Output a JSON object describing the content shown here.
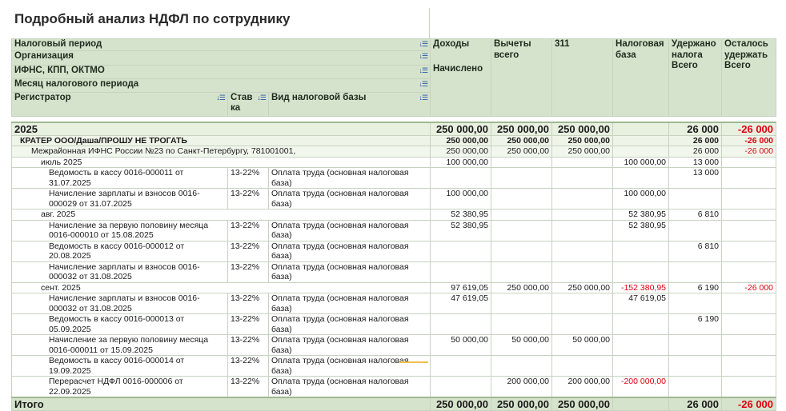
{
  "title": "Подробный анализ НДФЛ по сотруднику",
  "headers": {
    "tax_period": "Налоговый период",
    "organization": "Организация",
    "ifns": "ИФНС, КПП, ОКТМО",
    "month": "Месяц налогового периода",
    "registrar": "Регистратор",
    "rate": "Став ка",
    "base_type": "Вид налоговой базы",
    "income": "Доходы",
    "income_sub": "Начислено",
    "deductions": "Вычеты всего",
    "code311": "311",
    "tax_base": "Налоговая база",
    "withheld": "Удержано налога",
    "withheld_sub": "Всего",
    "remaining": "Осталось удержать",
    "remaining_sub": "Всего"
  },
  "sort_icon": "sort-icon",
  "rows": [
    {
      "level": "g0",
      "label": "2025",
      "income": "250 000,00",
      "ded": "250 000,00",
      "c311": "250 000,00",
      "base": "",
      "withheld": "26 000",
      "remain": "-26 000",
      "remain_neg": true
    },
    {
      "level": "g1",
      "label": "КРАТЕР ООО/Даша/ПРОШУ НЕ ТРОГАТЬ",
      "income": "250 000,00",
      "ded": "250 000,00",
      "c311": "250 000,00",
      "base": "",
      "withheld": "26 000",
      "remain": "-26 000",
      "remain_neg": true
    },
    {
      "level": "g2",
      "label": "Межрайонная ИФНС России №23 по Санкт-Петербургу, 781001001,",
      "income": "250 000,00",
      "ded": "250 000,00",
      "c311": "250 000,00",
      "base": "",
      "withheld": "26 000",
      "remain": "-26 000",
      "remain_neg": true
    },
    {
      "level": "g3",
      "label": "июль 2025",
      "income": "100 000,00",
      "ded": "",
      "c311": "",
      "base": "100 000,00",
      "withheld": "13 000",
      "remain": ""
    },
    {
      "level": "d",
      "label": "Ведомость в кассу 0016-000011 от 31.07.2025",
      "rate": "13-22%",
      "btype": "Оплата труда (основная налоговая база)",
      "income": "",
      "ded": "",
      "c311": "",
      "base": "",
      "withheld": "13 000",
      "remain": ""
    },
    {
      "level": "d",
      "label": "Начисление зарплаты и взносов 0016-000029 от 31.07.2025",
      "rate": "13-22%",
      "btype": "Оплата труда (основная налоговая база)",
      "income": "100 000,00",
      "ded": "",
      "c311": "",
      "base": "100 000,00",
      "withheld": "",
      "remain": ""
    },
    {
      "level": "g3",
      "label": "авг. 2025",
      "income": "52 380,95",
      "ded": "",
      "c311": "",
      "base": "52 380,95",
      "withheld": "6 810",
      "remain": ""
    },
    {
      "level": "d",
      "label": "Начисление за первую половину месяца 0016-000010 от 15.08.2025",
      "rate": "13-22%",
      "btype": "Оплата труда (основная налоговая база)",
      "income": "52 380,95",
      "ded": "",
      "c311": "",
      "base": "52 380,95",
      "withheld": "",
      "remain": ""
    },
    {
      "level": "d",
      "label": "Ведомость в кассу 0016-000012 от 20.08.2025",
      "rate": "13-22%",
      "btype": "Оплата труда (основная налоговая база)",
      "income": "",
      "ded": "",
      "c311": "",
      "base": "",
      "withheld": "6 810",
      "remain": ""
    },
    {
      "level": "d",
      "label": "Начисление зарплаты и взносов 0016-000032 от 31.08.2025",
      "rate": "13-22%",
      "btype": "Оплата труда (основная налоговая база)",
      "income": "",
      "ded": "",
      "c311": "",
      "base": "",
      "withheld": "",
      "remain": ""
    },
    {
      "level": "g3",
      "label": "сент. 2025",
      "income": "97 619,05",
      "ded": "250 000,00",
      "c311": "250 000,00",
      "base": "-152 380,95",
      "base_neg": true,
      "withheld": "6 190",
      "remain": "-26 000",
      "remain_neg": true
    },
    {
      "level": "d",
      "label": "Начисление зарплаты и взносов 0016-000032 от 31.08.2025",
      "rate": "13-22%",
      "btype": "Оплата труда (основная налоговая база)",
      "income": "47 619,05",
      "ded": "",
      "c311": "",
      "base": "47 619,05",
      "withheld": "",
      "remain": ""
    },
    {
      "level": "d",
      "label": "Ведомость в кассу 0016-000013 от 05.09.2025",
      "rate": "13-22%",
      "btype": "Оплата труда (основная налоговая база)",
      "income": "",
      "ded": "",
      "c311": "",
      "base": "",
      "withheld": "6 190",
      "remain": ""
    },
    {
      "level": "d",
      "label": "Начисление за первую половину месяца 0016-000011 от 15.09.2025",
      "rate": "13-22%",
      "btype": "Оплата труда (основная налоговая база)",
      "income": "50 000,00",
      "ded": "50 000,00",
      "c311": "50 000,00",
      "base": "",
      "withheld": "",
      "remain": ""
    },
    {
      "level": "d",
      "label": "Ведомость в кассу 0016-000014 от 19.09.2025",
      "rate": "13-22%",
      "btype": "Оплата труда (основная налоговая база)",
      "income": "",
      "ded": "",
      "c311": "",
      "base": "",
      "withheld": "",
      "remain": ""
    },
    {
      "level": "d",
      "label": "Перерасчет НДФЛ 0016-000006 от 22.09.2025",
      "rate": "13-22%",
      "btype": "Оплата труда (основная налоговая база)",
      "income": "",
      "ded": "200 000,00",
      "c311": "200 000,00",
      "base": "-200 000,00",
      "base_neg": true,
      "withheld": "",
      "remain": ""
    }
  ],
  "total": {
    "label": "Итого",
    "income": "250 000,00",
    "ded": "250 000,00",
    "c311": "250 000,00",
    "base": "",
    "withheld": "26 000",
    "remain": "-26 000",
    "remain_neg": true
  }
}
